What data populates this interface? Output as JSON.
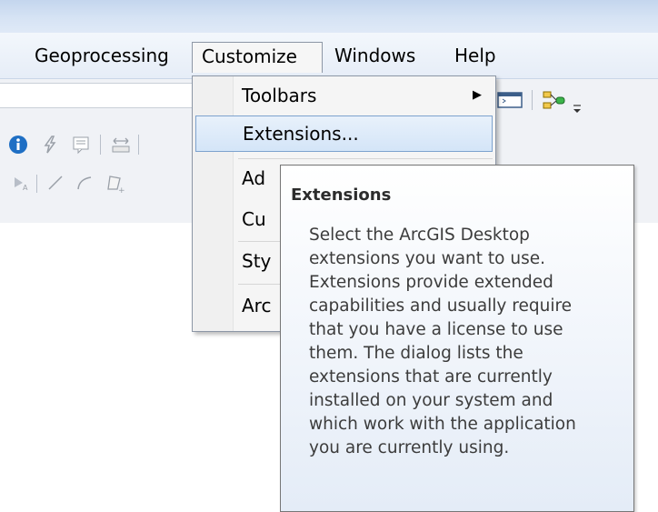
{
  "menubar": {
    "items": [
      {
        "label": "Geoprocessing"
      },
      {
        "label": "Customize"
      },
      {
        "label": "Windows"
      },
      {
        "label": "Help"
      }
    ]
  },
  "customize_menu": {
    "items": [
      {
        "label": "Toolbars",
        "has_submenu": true
      },
      {
        "label": "Extensions...",
        "highlighted": true
      },
      {
        "label": "Ad"
      },
      {
        "label": "Cu"
      },
      {
        "label": "Sty"
      },
      {
        "label": "Arc"
      }
    ],
    "submenu_arrow": "▶"
  },
  "tooltip": {
    "title": "Extensions",
    "lines": [
      "Select the ArcGIS Desktop",
      "extensions you want to use.",
      "Extensions provide extended",
      "capabilities and usually require",
      "that you have a license to use",
      "them. The dialog lists the",
      "extensions that are currently",
      "installed on your system and",
      "which work with the application",
      "you are currently using."
    ]
  },
  "toolbar_icons": {
    "row1": [
      "info-icon",
      "lightning-icon",
      "html-popup-icon",
      "measure-icon"
    ],
    "row2": [
      "label-icon",
      "line-icon",
      "curve-icon",
      "polygon-icon"
    ],
    "right": [
      "window-icon",
      "model-builder-icon",
      "toolbar-options-icon"
    ]
  },
  "colors": {
    "highlight_border": "#7da2ce",
    "info_blue": "#1f6fc4"
  }
}
